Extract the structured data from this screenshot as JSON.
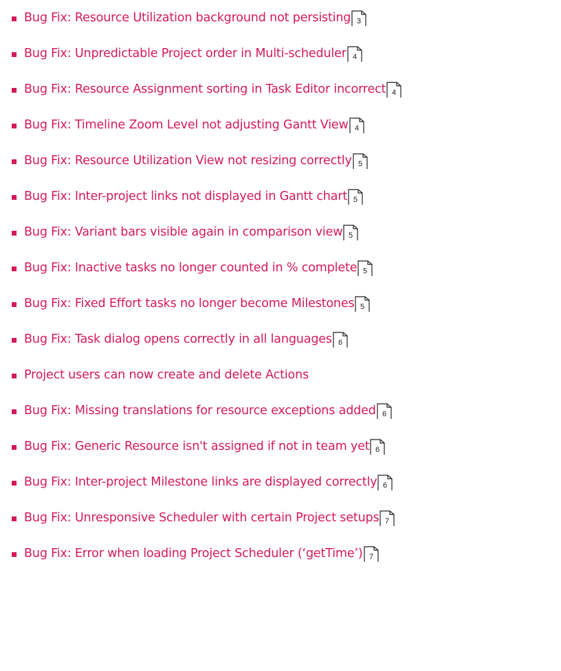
{
  "colors": {
    "link": "#d41b5a",
    "bullet": "#d41b5a",
    "page_icon_stroke": "#222222"
  },
  "icons": {
    "bullet": "square-bullet-icon",
    "page_ref": "page-icon"
  },
  "toc": {
    "items": [
      {
        "label": "Bug Fix: Resource Utilization background not persisting",
        "page": "3"
      },
      {
        "label": "Bug Fix: Unpredictable Project order in Multi-scheduler",
        "page": "4"
      },
      {
        "label": "Bug Fix: Resource Assignment sorting in Task Editor incorrect",
        "page": "4"
      },
      {
        "label": "Bug Fix: Timeline Zoom Level not adjusting Gantt View",
        "page": "4"
      },
      {
        "label": "Bug Fix: Resource Utilization View not resizing correctly",
        "page": "5"
      },
      {
        "label": "Bug Fix: Inter-project links not displayed in Gantt chart",
        "page": "5"
      },
      {
        "label": "Bug Fix: Variant bars visible again in comparison view",
        "page": "5"
      },
      {
        "label": "Bug Fix: Inactive tasks no longer counted in % complete",
        "page": "5"
      },
      {
        "label": "Bug Fix: Fixed Effort tasks no longer become Milestones",
        "page": "5"
      },
      {
        "label": "Bug Fix: Task dialog opens correctly in all languages",
        "page": "6"
      },
      {
        "label": "Project users can now create and delete Actions",
        "page": ""
      },
      {
        "label": "Bug Fix: Missing translations for resource exceptions added",
        "page": "6"
      },
      {
        "label": "Bug Fix: Generic Resource isn't assigned if not in team yet",
        "page": "6"
      },
      {
        "label": "Bug Fix: Inter-project Milestone links are displayed correctly",
        "page": "6"
      },
      {
        "label": "Bug Fix: Unresponsive Scheduler with certain Project setups",
        "page": "7"
      },
      {
        "label": "Bug Fix: Error when loading Project Scheduler (‘getTime’)",
        "page": "7"
      }
    ]
  }
}
